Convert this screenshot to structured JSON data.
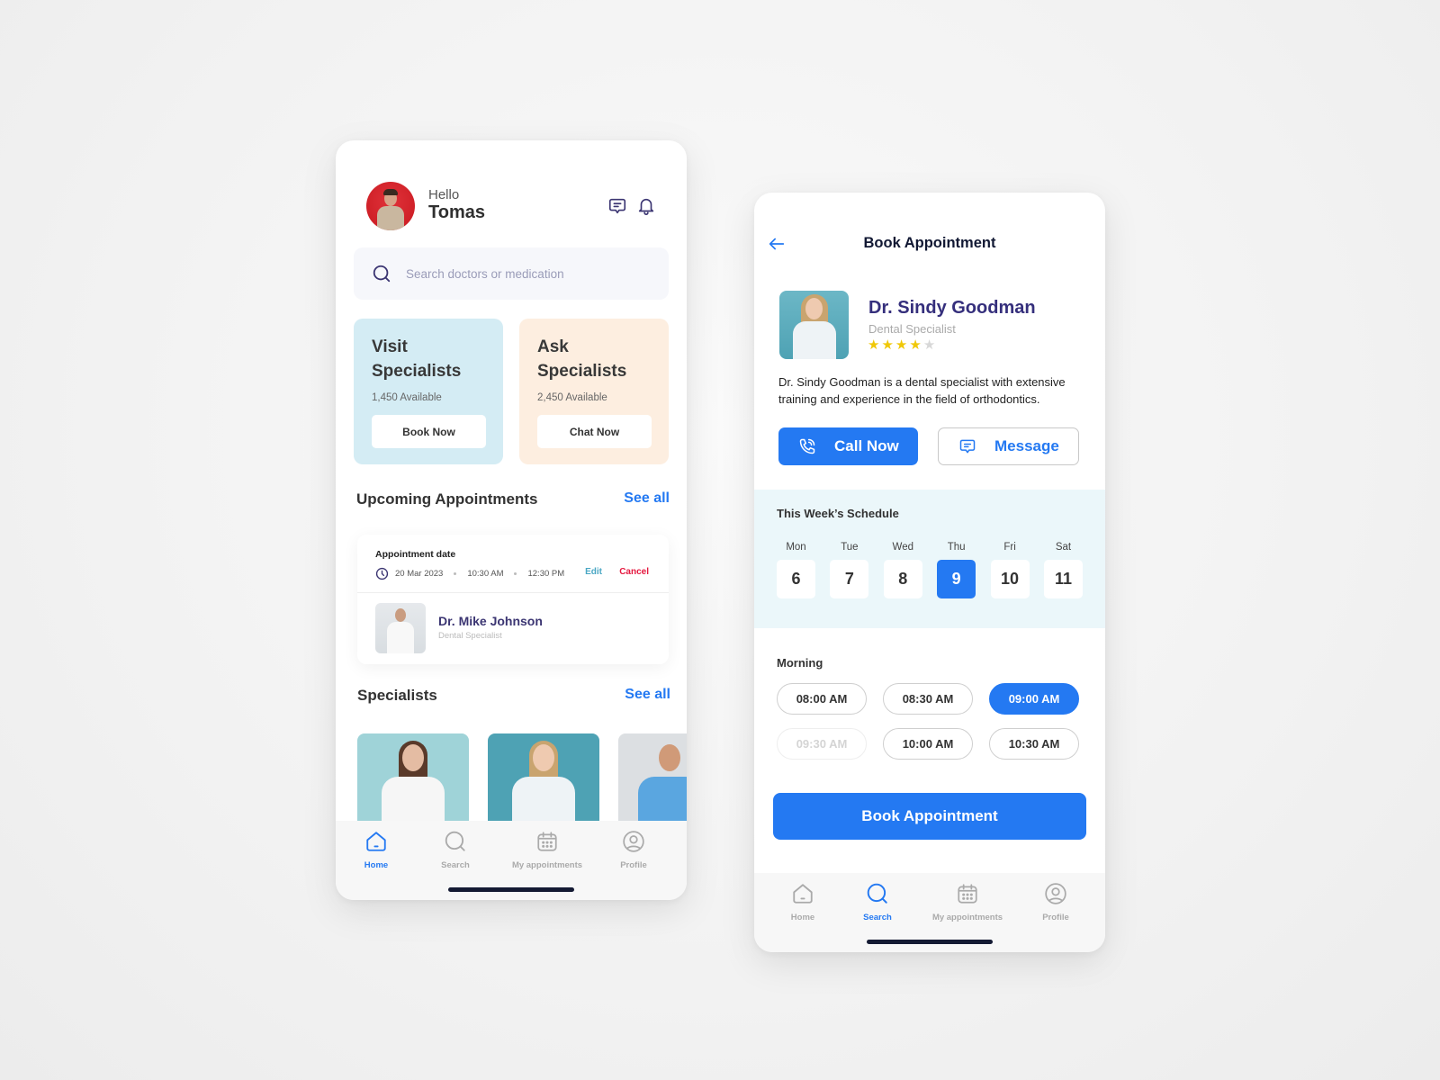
{
  "home": {
    "greeting": "Hello",
    "user_name": "Tomas",
    "icons": {
      "chat": "chat-bubble-icon",
      "notifications": "bell-icon",
      "search": "search-icon"
    },
    "search": {
      "placeholder": "Search doctors or medication",
      "value": ""
    },
    "promos": [
      {
        "title_line1": "Visit",
        "title_line2": "Specialists",
        "available": "1,450 Available",
        "button": "Book Now",
        "color": "#d4ecf4"
      },
      {
        "title_line1": "Ask",
        "title_line2": "Specialists",
        "available": "2,450 Available",
        "button": "Chat Now",
        "color": "#fdeee0"
      }
    ],
    "upcoming": {
      "title": "Upcoming Appointments",
      "see_all": "See all",
      "appointment": {
        "label": "Appointment date",
        "date": "20 Mar 2023",
        "start_time": "10:30 AM",
        "end_time": "12:30 PM",
        "edit": "Edit",
        "cancel": "Cancel",
        "doctor_name": "Dr. Mike Johnson",
        "doctor_specialty": "Dental Specialist"
      }
    },
    "specialists": {
      "title": "Specialists",
      "see_all": "See all"
    },
    "tabbar": [
      {
        "label": "Home",
        "icon": "home-icon",
        "active": true
      },
      {
        "label": "Search",
        "icon": "search-icon",
        "active": false
      },
      {
        "label": "My appointments",
        "icon": "calendar-icon",
        "active": false
      },
      {
        "label": "Profile",
        "icon": "profile-icon",
        "active": false
      }
    ]
  },
  "booking": {
    "title": "Book Appointment",
    "doctor": {
      "name": "Dr. Sindy Goodman",
      "specialty": "Dental Specialist",
      "rating": 4,
      "rating_max": 5,
      "bio": "Dr. Sindy Goodman is a dental specialist with extensive training and experience in the field of orthodontics."
    },
    "call_label": "Call Now",
    "message_label": "Message",
    "schedule": {
      "title": "This Week’s Schedule",
      "days": [
        {
          "name": "Mon",
          "date": "6",
          "selected": false
        },
        {
          "name": "Tue",
          "date": "7",
          "selected": false
        },
        {
          "name": "Wed",
          "date": "8",
          "selected": false
        },
        {
          "name": "Thu",
          "date": "9",
          "selected": true
        },
        {
          "name": "Fri",
          "date": "10",
          "selected": false
        },
        {
          "name": "Sat",
          "date": "11",
          "selected": false
        }
      ]
    },
    "morning": {
      "title": "Morning",
      "slots": [
        {
          "time": "08:00 AM",
          "state": "available"
        },
        {
          "time": "08:30 AM",
          "state": "available"
        },
        {
          "time": "09:00 AM",
          "state": "selected"
        },
        {
          "time": "09:30 AM",
          "state": "disabled"
        },
        {
          "time": "10:00 AM",
          "state": "available"
        },
        {
          "time": "10:30 AM",
          "state": "available"
        }
      ]
    },
    "book_label": "Book Appointment",
    "tabbar": [
      {
        "label": "Home",
        "icon": "home-icon",
        "active": false
      },
      {
        "label": "Search",
        "icon": "search-icon",
        "active": true
      },
      {
        "label": "My appointments",
        "icon": "calendar-icon",
        "active": false
      },
      {
        "label": "Profile",
        "icon": "profile-icon",
        "active": false
      }
    ]
  },
  "colors": {
    "accent": "#2479f2",
    "doctor_name": "#352f7c",
    "cancel": "#e5183f",
    "edit": "#4aa7c4",
    "star": "#f0c808",
    "schedule_bg": "#ebf7fa"
  }
}
